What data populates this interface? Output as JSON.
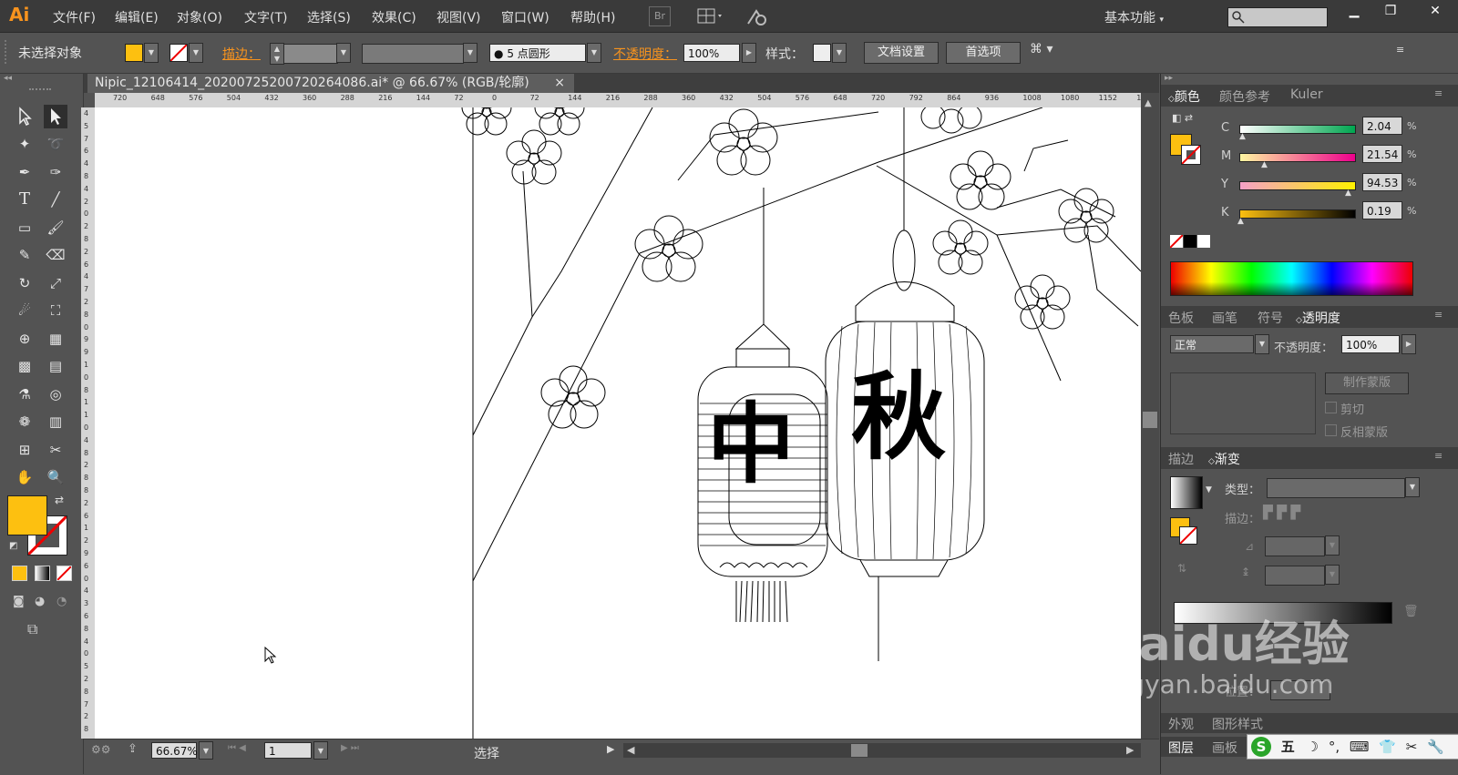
{
  "app": {
    "logo": "Ai",
    "workspace": "基本功能"
  },
  "menu": [
    "文件(F)",
    "编辑(E)",
    "对象(O)",
    "文字(T)",
    "选择(S)",
    "效果(C)",
    "视图(V)",
    "窗口(W)",
    "帮助(H)"
  ],
  "menubar_icons": {
    "bridge": "Br"
  },
  "control": {
    "no_selection": "未选择对象",
    "stroke_label": "描边：",
    "brush": "5 点圆形",
    "opacity_label": "不透明度：",
    "opacity_value": "100%",
    "style_label": "样式：",
    "doc_setup": "文档设置",
    "prefs": "首选项"
  },
  "document": {
    "tab_title": "Nipic_12106414_20200725200720264086.ai* @ 66.67% (RGB/轮廓)",
    "close": "×",
    "hruler_ticks": [
      "720",
      "648",
      "576",
      "504",
      "432",
      "360",
      "288",
      "216",
      "144",
      "72",
      "0",
      "72",
      "144",
      "216",
      "288",
      "360",
      "432",
      "504",
      "576",
      "648",
      "720",
      "792",
      "864",
      "936",
      "1008",
      "1080",
      "1152",
      "1224",
      "1296"
    ],
    "vruler_ticks": [
      "4",
      "5",
      "7",
      "6",
      "4",
      "8",
      "4",
      "2",
      "0",
      "2",
      "8",
      "2",
      "6",
      "4",
      "7",
      "2",
      "8",
      "0",
      "9",
      "9",
      "1",
      "0",
      "8",
      "1",
      "1",
      "0",
      "4",
      "8",
      "2",
      "8",
      "8",
      "2",
      "6",
      "1",
      "2",
      "9",
      "6",
      "0",
      "4",
      "3",
      "6",
      "8",
      "4",
      "0",
      "5",
      "2",
      "8",
      "7",
      "2",
      "8"
    ],
    "lantern_text_left": "中",
    "lantern_text_right": "秋"
  },
  "status": {
    "zoom": "66.67%",
    "page": "1",
    "tool": "选择"
  },
  "color_panel": {
    "tabs": [
      "颜色",
      "颜色参考",
      "Kuler"
    ],
    "channels": [
      {
        "name": "C",
        "value": "2.04",
        "pct": 0.02,
        "gradient": "linear-gradient(90deg,#fff,#00a650)"
      },
      {
        "name": "M",
        "value": "21.54",
        "pct": 0.22,
        "gradient": "linear-gradient(90deg,#fff6a0,#ec008c)"
      },
      {
        "name": "Y",
        "value": "94.53",
        "pct": 0.95,
        "gradient": "linear-gradient(90deg,#f5a0c8,#fff200)"
      },
      {
        "name": "K",
        "value": "0.19",
        "pct": 0.0,
        "gradient": "linear-gradient(90deg,#fdc010,#000)"
      }
    ],
    "unit": "%"
  },
  "transparency_panel": {
    "tabs": [
      "色板",
      "画笔",
      "符号",
      "透明度"
    ],
    "blend_mode": "正常",
    "opacity_label": "不透明度：",
    "opacity_value": "100%",
    "make_mask": "制作蒙版",
    "clip": "剪切",
    "invert": "反相蒙版"
  },
  "gradient_panel": {
    "tabs": [
      "描边",
      "渐变"
    ],
    "type_label": "类型：",
    "stroke_label": "描边：",
    "location_label": "位置："
  },
  "bottom_tabs": {
    "row1": [
      "外观",
      "图形样式"
    ],
    "row2": [
      "图层",
      "画板"
    ]
  },
  "watermark": {
    "brand": "Baidu经验",
    "url": "jingyan.baidu.com"
  },
  "ime": {
    "label": "五"
  },
  "colors": {
    "fill": "#fdc010",
    "accent": "#f7931e"
  }
}
